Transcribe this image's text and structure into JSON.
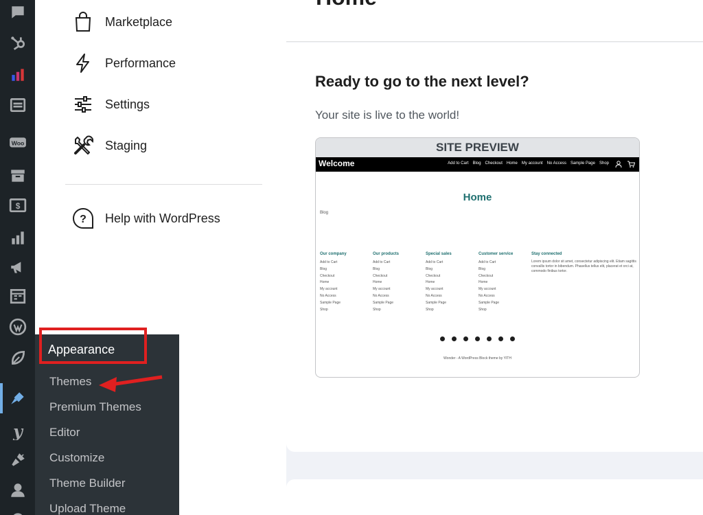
{
  "page": {
    "title": "Home"
  },
  "nav_panel": {
    "items": [
      {
        "label": "Marketplace",
        "icon": "bag-icon"
      },
      {
        "label": "Performance",
        "icon": "bolt-icon"
      },
      {
        "label": "Settings",
        "icon": "sliders-icon"
      },
      {
        "label": "Staging",
        "icon": "tools-icon"
      }
    ],
    "help": {
      "label": "Help with WordPress",
      "icon": "help-icon"
    }
  },
  "main": {
    "headline": "Ready to go to the next level?",
    "subtext": "Your site is live to the world!"
  },
  "site_preview": {
    "header": "SITE PREVIEW",
    "brand": "Welcome",
    "menu": [
      "Add to Cart",
      "Blog",
      "Checkout",
      "Home",
      "My account",
      "No Access",
      "Sample Page",
      "Shop"
    ],
    "home_heading": "Home",
    "blog_link": "Blog",
    "columns": [
      {
        "title": "Our company",
        "links": [
          "Add to Cart",
          "Blog",
          "Checkout",
          "Home",
          "My account",
          "No Access",
          "Sample Page",
          "Shop"
        ]
      },
      {
        "title": "Our products",
        "links": [
          "Add to Cart",
          "Blog",
          "Checkout",
          "Home",
          "My account",
          "No Access",
          "Sample Page",
          "Shop"
        ]
      },
      {
        "title": "Special sales",
        "links": [
          "Add to Cart",
          "Blog",
          "Checkout",
          "Home",
          "My account",
          "No Access",
          "Sample Page",
          "Shop"
        ]
      },
      {
        "title": "Customer service",
        "links": [
          "Add to Cart",
          "Blog",
          "Checkout",
          "Home",
          "My account",
          "No Access",
          "Sample Page",
          "Shop"
        ]
      }
    ],
    "stay_connected": {
      "title": "Stay connected",
      "text": "Lorem ipsum dolor sit amet, consectetur adipiscing elit. Etiam sagittis convallis tortor in bibendum. Phasellus tellus elit, placerat et orci at, commodo finibus tortor."
    },
    "footer": "Wonder - A WordPress Block theme by YITH"
  },
  "appearance_menu": {
    "title": "Appearance",
    "items": [
      "Themes",
      "Premium Themes",
      "Editor",
      "Customize",
      "Theme Builder",
      "Upload Theme"
    ]
  },
  "colors": {
    "admin_bar": "#1d2327",
    "flyout": "#2c3338",
    "active_accent": "#72aee6",
    "annotation_red": "#e02020",
    "preview_teal": "#1e6f6f"
  }
}
